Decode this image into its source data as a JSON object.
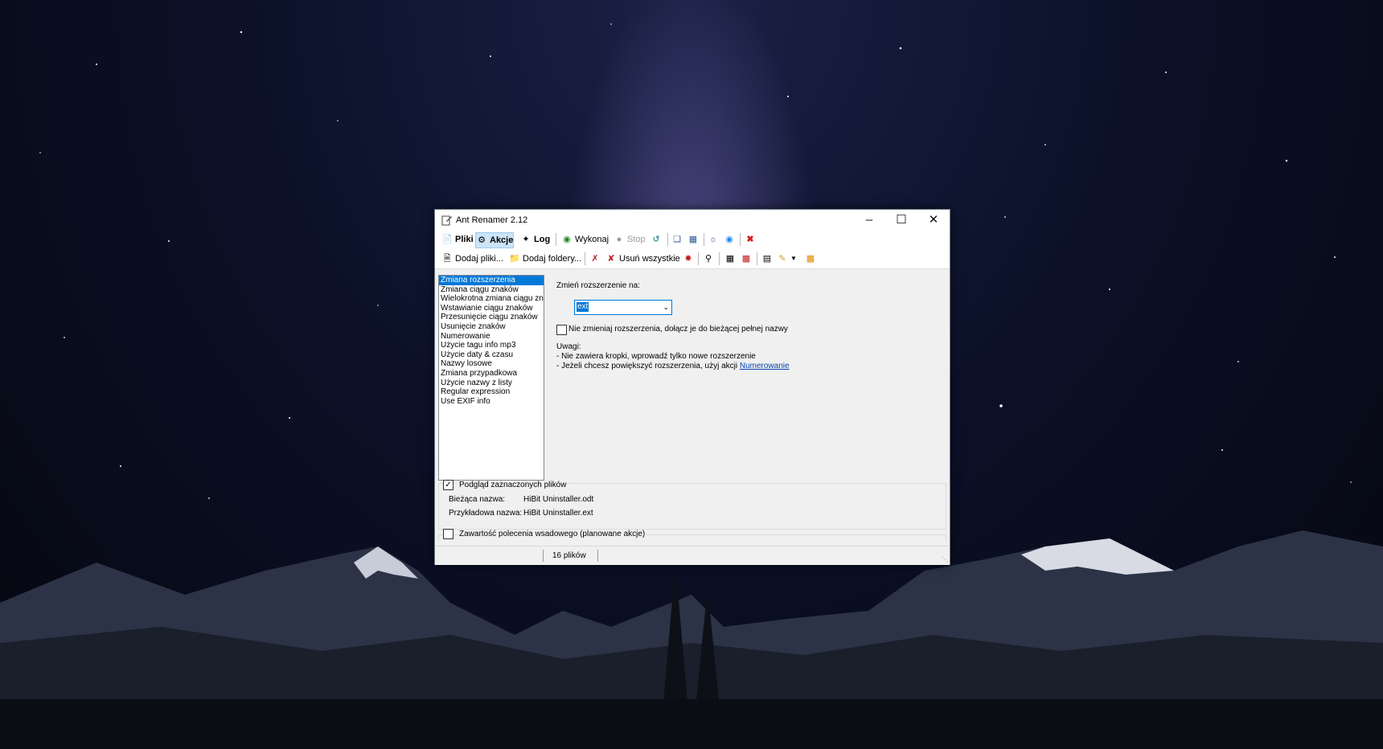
{
  "window": {
    "title": "Ant Renamer 2.12"
  },
  "toolbar1": {
    "pliki": "Pliki",
    "akcje": "Akcje",
    "log": "Log",
    "wykonaj": "Wykonaj",
    "stop": "Stop"
  },
  "toolbar2": {
    "dodaj_pliki": "Dodaj pliki...",
    "dodaj_foldery": "Dodaj foldery...",
    "usun_wszystkie": "Usuń wszystkie"
  },
  "actions": {
    "items": [
      "Zmiana rozszerzenia",
      "Zmiana ciągu znaków",
      "Wielokrotna zmiana ciągu znak",
      "Wstawianie ciągu znaków",
      "Przesunięcie ciągu znaków",
      "Usunięcie znaków",
      "Numerowanie",
      "Użycie tagu info mp3",
      "Użycie daty & czasu",
      "Nazwy losowe",
      "Zmiana przypadkowa",
      "Użycie nazwy z listy",
      "Regular expression",
      "Use EXIF info"
    ],
    "selected": "Zmiana rozszerzenia"
  },
  "panel": {
    "label": "Zmień rozszerzenie na:",
    "combo_value": "ext",
    "checkbox_label": "Nie zmieniaj rozszerzenia, dołącz je do bieżącej pełnej nazwy",
    "notes_title": "Uwagi:",
    "note1": "- Nie zawiera kropki, wprowadź tylko nowe rozszerzenie",
    "note2_prefix": "- Jeżeli chcesz powiększyć rozszerzenia, użyj akcji ",
    "note2_link": "Numerowanie"
  },
  "preview": {
    "checkbox_label": "Podgląd zaznaczonych plików",
    "checked": true,
    "current_label": "Bieżąca nazwa:",
    "current_value": "HiBit Uninstaller.odt",
    "example_label": "Przykładowa nazwa:",
    "example_value": "HiBit Uninstaller.ext"
  },
  "batch": {
    "checkbox_label": "Zawartość polecenia wsadowego (planowane akcje)",
    "checked": false
  },
  "status": {
    "files": "16 plików"
  },
  "colors": {
    "selection": "#0078d7",
    "link": "#0645ad",
    "window_bg": "#f0f0f0"
  }
}
